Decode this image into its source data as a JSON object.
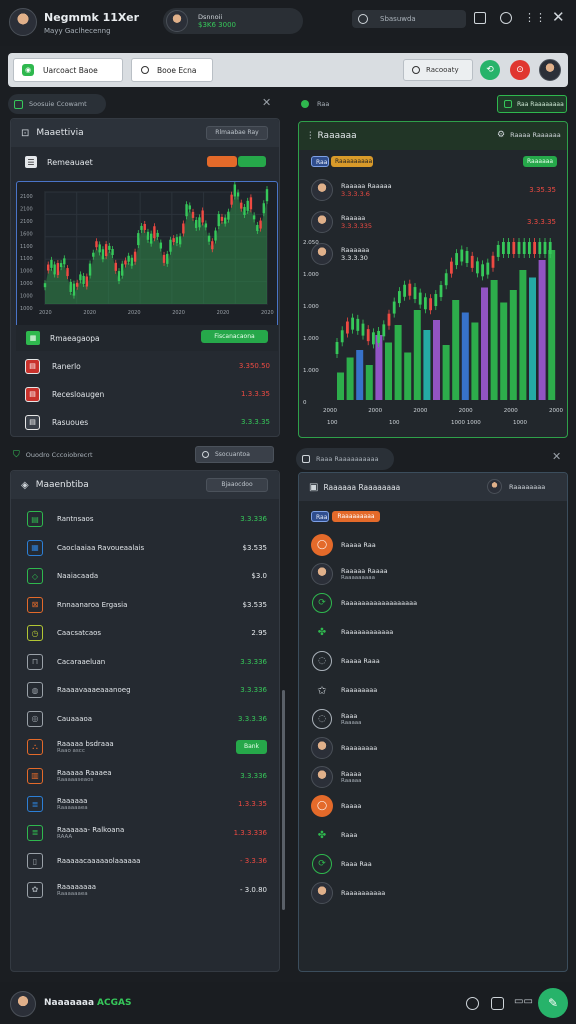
{
  "app": {
    "title": "Negmmk 11Xer",
    "subtitle": "Mayy Gaclhecenng",
    "profile_name": "Dsnnoii",
    "profile_value": "$3K6 3000",
    "search_placeholder": "Sbasuwda"
  },
  "toolbar": {
    "tab_label": "Uarcoact Baoe",
    "filter_label": "Booe Ecna",
    "right_field": "Racooaty"
  },
  "left_top": {
    "tab_label": "Soosuie Ccowamt",
    "header_title": "Maaettivia",
    "header_button": "Rlmaabae Ray",
    "section_title": "Remeauaet",
    "chart_caption": "Rmaeagaopa",
    "chart_button": "Fiscanacaona",
    "y_ticks": [
      "2100",
      "2100",
      "2100",
      "1600",
      "1100",
      "1100",
      "1000",
      "1000",
      "1000",
      "1000"
    ],
    "x_ticks": [
      "2020",
      "2020",
      "2020",
      "2020",
      "2020",
      "2020"
    ],
    "rows": [
      {
        "label": "Ranerlo",
        "value": "3.350.50",
        "color": "red",
        "icon": "square-icon"
      },
      {
        "label": "Recesloaugen",
        "value": "1.3.3.35",
        "color": "red",
        "icon": "square-icon"
      },
      {
        "label": "Rasuoues",
        "value": "3.3.3.35",
        "color": "green",
        "icon": "square-icon"
      }
    ]
  },
  "left_bottom": {
    "tab_label": "Ouodro Cccoiobrecrt",
    "tab_button": "Ssocuantoa",
    "header_title": "Maaenbtiba",
    "header_button": "Bjaaocdoo",
    "rows": [
      {
        "label": "Rantnsaos",
        "value": "3.3.336",
        "color": "green",
        "icon_color": "#2fb84e",
        "icon": "bank-icon"
      },
      {
        "label": "Caoclaaiaa Ravoueaalais",
        "value": "$3.535",
        "color": "white",
        "icon_color": "#2c7fd6",
        "icon": "grid-icon"
      },
      {
        "label": "Naaiacaada",
        "value": "$3.0",
        "color": "white",
        "icon_color": "#2fb84e",
        "icon": "tag-icon"
      },
      {
        "label": "Rnnaanaroa Ergasia",
        "value": "$3.535",
        "color": "white",
        "icon_color": "#e46a2a",
        "icon": "box-icon"
      },
      {
        "label": "Caacsatcaos",
        "value": "2.95",
        "color": "white",
        "icon_color": "#b2c634",
        "icon": "clock-icon"
      },
      {
        "label": "Cacaraaeluan",
        "value": "3.3.336",
        "color": "green",
        "icon_color": "#9aa1a8",
        "icon": "bucket-icon"
      },
      {
        "label": "Raaaavaaaeaaanoeg",
        "value": "3.3.336",
        "color": "green",
        "icon_color": "#9aa1a8",
        "icon": "globe-icon"
      },
      {
        "label": "Cauaaaoa",
        "value": "3.3.3.36",
        "color": "green",
        "icon_color": "#9aa1a8",
        "icon": "compass-icon"
      },
      {
        "label": "Raaaaa bsdraaa",
        "sub": "Raao ascc",
        "value": "Bank",
        "color": "badge",
        "icon_color": "#e46a2a",
        "icon": "basket-icon"
      },
      {
        "label": "Raaaaa Raaaea",
        "sub": "Raaaaaseaos",
        "value": "3.3.336",
        "color": "green",
        "icon_color": "#e46a2a",
        "icon": "shop-icon"
      },
      {
        "label": "Raaaaaa",
        "sub": "Raaaaaaea",
        "value": "1.3.3.35",
        "color": "red",
        "icon_color": "#2c7fd6",
        "icon": "doc-icon"
      },
      {
        "label": "Raaaaaa- Ralkoana",
        "sub": "RAAA",
        "value": "1.3.3.336",
        "color": "red",
        "icon_color": "#2fb84e",
        "icon": "doc-icon"
      },
      {
        "label": "Raaaaacaaaaaolaaaaaa",
        "value": "- 3.3.36",
        "color": "red",
        "icon_color": "#9aa1a8",
        "icon": "file-icon"
      },
      {
        "label": "Raaaaaaaa",
        "sub": "Raaaaaaea",
        "value": "- 3.0.80",
        "color": "white",
        "icon_color": "#9aa1a8",
        "icon": "flower-icon"
      }
    ]
  },
  "right_top": {
    "tab_label": "Raa",
    "tab_button": "Raa Raaaaaaaa",
    "header_title": "Raaaaaa",
    "header_button": "Raaaa Raaaaaa",
    "legend_blue": "Raa",
    "legend_orange": "Raaaaaaaaa",
    "legend_green": "Raaaaaa",
    "avatars": [
      {
        "name": "Raaaaa Raaaaa",
        "value": "3.3.3.3.6",
        "value2": "3.35.35",
        "color": "red"
      },
      {
        "name": "Raaaaa",
        "value": "3.3.3.335",
        "value2": "3.3.3.35",
        "color": "red"
      },
      {
        "name": "Raaaaaa",
        "value": "3.3.3.30",
        "value2": "",
        "color": "white"
      }
    ],
    "y_ticks": [
      "2.050",
      "1.000",
      "1.000",
      "1.000",
      "1.000",
      "0"
    ],
    "x_ticks": [
      "2000",
      "2000",
      "2000",
      "2000",
      "2000",
      "2000"
    ],
    "x_ticks2": [
      "100",
      "100",
      "1000 1000",
      "1000"
    ]
  },
  "right_bottom": {
    "tab_label": "Raaa Raaaaaaaaaa",
    "header_title": "Raaaaaa Raaaaaaaa",
    "header_user": "Raaaaaaaa",
    "legend_blue": "Raa",
    "legend_orange": "Raaaaaaaaa",
    "items": [
      {
        "label": "Raaaa Raa",
        "kind": "orange-circle"
      },
      {
        "label": "Raaaaa Raaaa",
        "sub": "Raaaaaaaaa",
        "kind": "avatar"
      },
      {
        "label": "Raaaaaaaaaaaaaaaaaa",
        "kind": "green-circle"
      },
      {
        "label": "Raaaaaaaaaaaa",
        "kind": "leaf"
      },
      {
        "label": "Raaaa Raaa",
        "kind": "gray-circle"
      },
      {
        "label": "Raaaaaaaa",
        "kind": "star"
      },
      {
        "label": "Raaa",
        "sub": "Raaaaa",
        "kind": "gray-circle"
      },
      {
        "label": "Raaaaaaaa",
        "kind": "avatar"
      },
      {
        "label": "Raaaa",
        "sub": "Raaaaa",
        "kind": "avatar"
      },
      {
        "label": "Raaaa",
        "kind": "orange-circle"
      },
      {
        "label": "Raaa",
        "kind": "leaf"
      },
      {
        "label": "Raaa Raa",
        "kind": "green-circle"
      },
      {
        "label": "Raaaaaaaaaa",
        "kind": "avatar"
      }
    ]
  },
  "footer": {
    "name": "Naaaaaaa",
    "badge": "ACGAS"
  },
  "colors": {
    "accent_green": "#2fb84e",
    "red": "#e0362f",
    "orange": "#e46a2a",
    "blue": "#2c7fd6",
    "purple": "#9b58d0"
  }
}
